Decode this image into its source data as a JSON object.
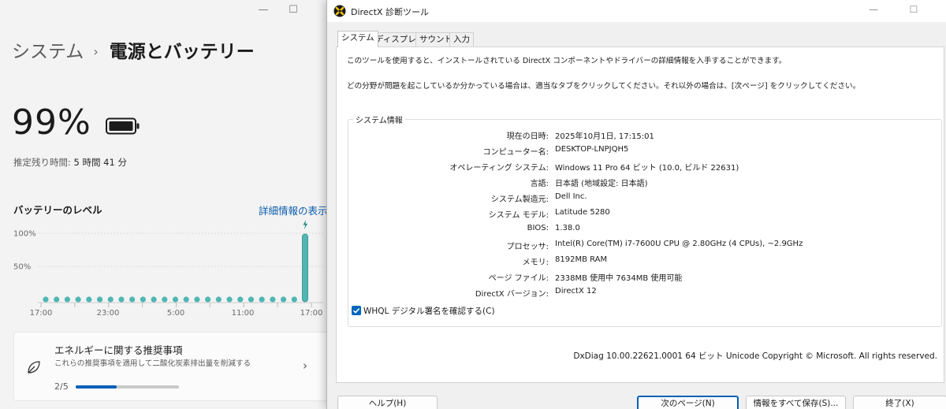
{
  "settings": {
    "breadcrumb_root": "システム",
    "breadcrumb_sep": "›",
    "breadcrumb_current": "電源とバッテリー",
    "battery_percent": "99%",
    "remaining_label": "推定残り時間: ",
    "remaining_value": "5 時間 41 分",
    "level_title": "バッテリーのレベル",
    "details_link": "詳細情報の表示",
    "chart_data": {
      "type": "bar",
      "ylabel_ticks": [
        "100%",
        "50%"
      ],
      "ylim": [
        0,
        100
      ],
      "x_tick_labels": [
        "17:00",
        "23:00",
        "5:00",
        "11:00",
        "17:00"
      ],
      "values": [
        0,
        0,
        0,
        0,
        0,
        0,
        0,
        0,
        0,
        0,
        0,
        0,
        0,
        0,
        0,
        0,
        0,
        0,
        0,
        0,
        0,
        0,
        0,
        0,
        99
      ],
      "charging_last": true,
      "bar_color": "#4fb6b3"
    },
    "energy": {
      "title": "エネルギーに関する推奨事項",
      "subtitle": "これらの推奨事項を適用して二酸化炭素排出量を削減する",
      "progress_text": "2/5",
      "progress_fraction": 0.4
    }
  },
  "dx": {
    "title": "DirectX 診断ツール",
    "tabs": [
      "システム",
      "ディスプレイ",
      "サウンド",
      "入力"
    ],
    "desc1": "このツールを使用すると、インストールされている DirectX コンポーネントやドライバーの詳細情報を入手することができます。",
    "desc2": "どの分野が問題を起こしているか分かっている場合は、適当なタブをクリックしてください。それ以外の場合は、[次ページ] をクリックしてください。",
    "sysinfo_title": "システム情報",
    "rows": [
      {
        "label": "現在の日時:",
        "value": "2025年10月1日, 17:15:01"
      },
      {
        "label": "コンピューター名:",
        "value": "DESKTOP-LNPJQH5"
      },
      {
        "label": "オペレーティング システム:",
        "value": "Windows 11 Pro 64 ビット (10.0, ビルド 22631)"
      },
      {
        "label": "言語:",
        "value": "日本語 (地域設定: 日本語)"
      },
      {
        "label": "システム製造元:",
        "value": "Dell Inc."
      },
      {
        "label": "システム モデル:",
        "value": "Latitude 5280"
      },
      {
        "label": "BIOS:",
        "value": "1.38.0"
      },
      {
        "label": "プロセッサ:",
        "value": "Intel(R) Core(TM) i7-7600U CPU @ 2.80GHz (4 CPUs), ~2.9GHz"
      },
      {
        "label": "メモリ:",
        "value": "8192MB RAM"
      },
      {
        "label": "ページ ファイル:",
        "value": "2338MB 使用中 7634MB 使用可能"
      },
      {
        "label": "DirectX バージョン:",
        "value": "DirectX 12"
      }
    ],
    "whql": "WHQL デジタル署名を確認する(C)",
    "footer": "DxDiag 10.00.22621.0001 64 ビット Unicode  Copyright © Microsoft. All rights reserved.",
    "buttons": {
      "help": "ヘルプ(H)",
      "next": "次のページ(N)",
      "save": "情報をすべて保存(S)...",
      "exit": "終了(X)"
    },
    "colors": {
      "accent": "#0067c0"
    }
  }
}
